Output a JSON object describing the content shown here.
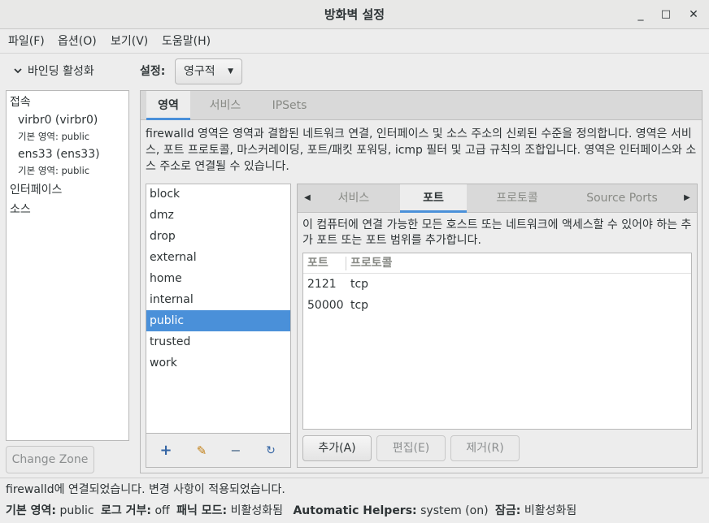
{
  "window": {
    "title": "방화벽 설정",
    "minimize": "_",
    "maximize": "□",
    "close": "✕"
  },
  "menubar": [
    "파일(F)",
    "옵션(O)",
    "보기(V)",
    "도움말(H)"
  ],
  "bindings": {
    "header": "바인딩 활성화",
    "connections_label": "접속",
    "connections": [
      {
        "name": "virbr0 (virbr0)",
        "zone": "기본 영역: public"
      },
      {
        "name": "ens33 (ens33)",
        "zone": "기본 영역: public"
      }
    ],
    "interfaces_label": "인터페이스",
    "sources_label": "소스",
    "change_zone": "Change Zone"
  },
  "config": {
    "label": "설정:",
    "value": "영구적"
  },
  "tabs": [
    "영역",
    "서비스",
    "IPSets"
  ],
  "zone_description": "firewalld 영역은 영역과 결합된 네트워크 연결, 인터페이스 및 소스 주소의 신뢰된 수준을 정의합니다. 영역은 서비스, 포트 프로토콜, 마스커레이딩, 포트/패킷 포워딩, icmp 필터 및 고급 규칙의 조합입니다. 영역은 인터페이스와 소스 주소로 연결될 수 있습니다.",
  "zones": [
    "block",
    "dmz",
    "drop",
    "external",
    "home",
    "internal",
    "public",
    "trusted",
    "work"
  ],
  "selected_zone": "public",
  "zone_toolbar": {
    "add": "+",
    "edit": "✎",
    "remove": "−",
    "reload": "↻"
  },
  "inner_tabs": [
    "서비스",
    "포트",
    "프로토콜",
    "Source Ports"
  ],
  "ports": {
    "description": "이 컴퓨터에 연결 가능한 모든 호스트 또는 네트워크에 액세스할 수 있어야 하는 추가 포트 또는 포트 범위를 추가합니다.",
    "columns": [
      "포트",
      "프로토콜"
    ],
    "rows": [
      {
        "port": "2121",
        "protocol": "tcp"
      },
      {
        "port": "50000",
        "protocol": "tcp"
      }
    ],
    "add": "추가(A)",
    "edit": "편집(E)",
    "remove": "제거(R)"
  },
  "status": {
    "message": "firewalld에 연결되었습니다. 변경 사항이 적용되었습니다.",
    "default_zone_label": "기본 영역:",
    "default_zone": "public",
    "log_denied_label": "로그 거부:",
    "log_denied": "off",
    "panic_label": "패닉 모드:",
    "panic": "비활성화됨",
    "helpers_label": "Automatic Helpers:",
    "helpers": "system (on)",
    "lockdown_label": "잠금:",
    "lockdown": "비활성화됨"
  },
  "colors": {
    "accent": "#4a90d9",
    "background": "#ededed"
  }
}
